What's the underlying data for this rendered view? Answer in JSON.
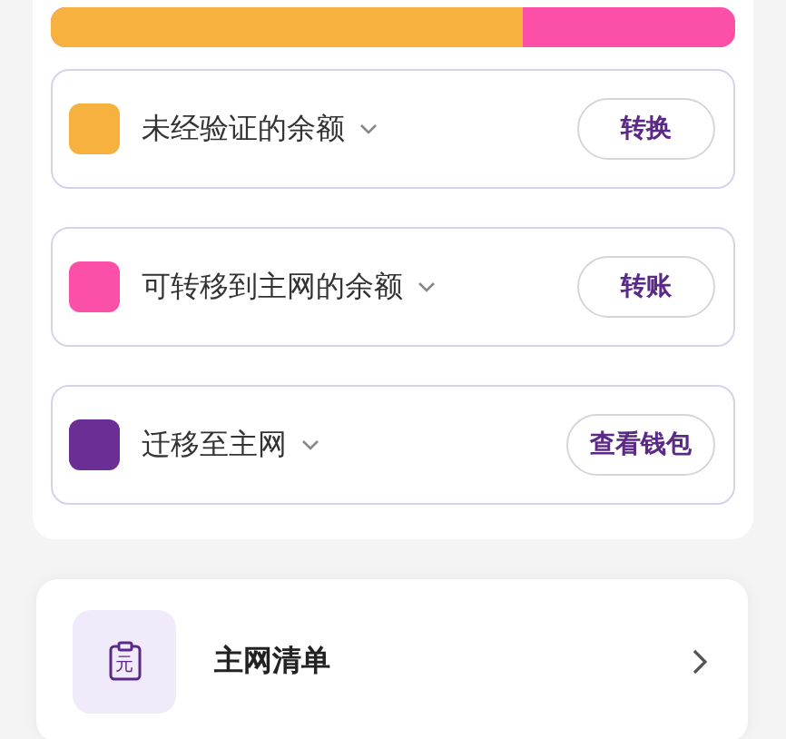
{
  "balance_bar": {
    "level": 0.69
  },
  "balances": [
    {
      "label": "未经验证的余额",
      "color": "#f7b13e",
      "button": "转换"
    },
    {
      "label": "可转移到主网的余额",
      "color": "#fb4fa8",
      "button": "转账"
    },
    {
      "label": "迁移至主网",
      "color": "#6a2e94",
      "button": "查看钱包"
    }
  ],
  "mainnet_list": {
    "icon_glyph": "元",
    "title": "主网清单"
  }
}
